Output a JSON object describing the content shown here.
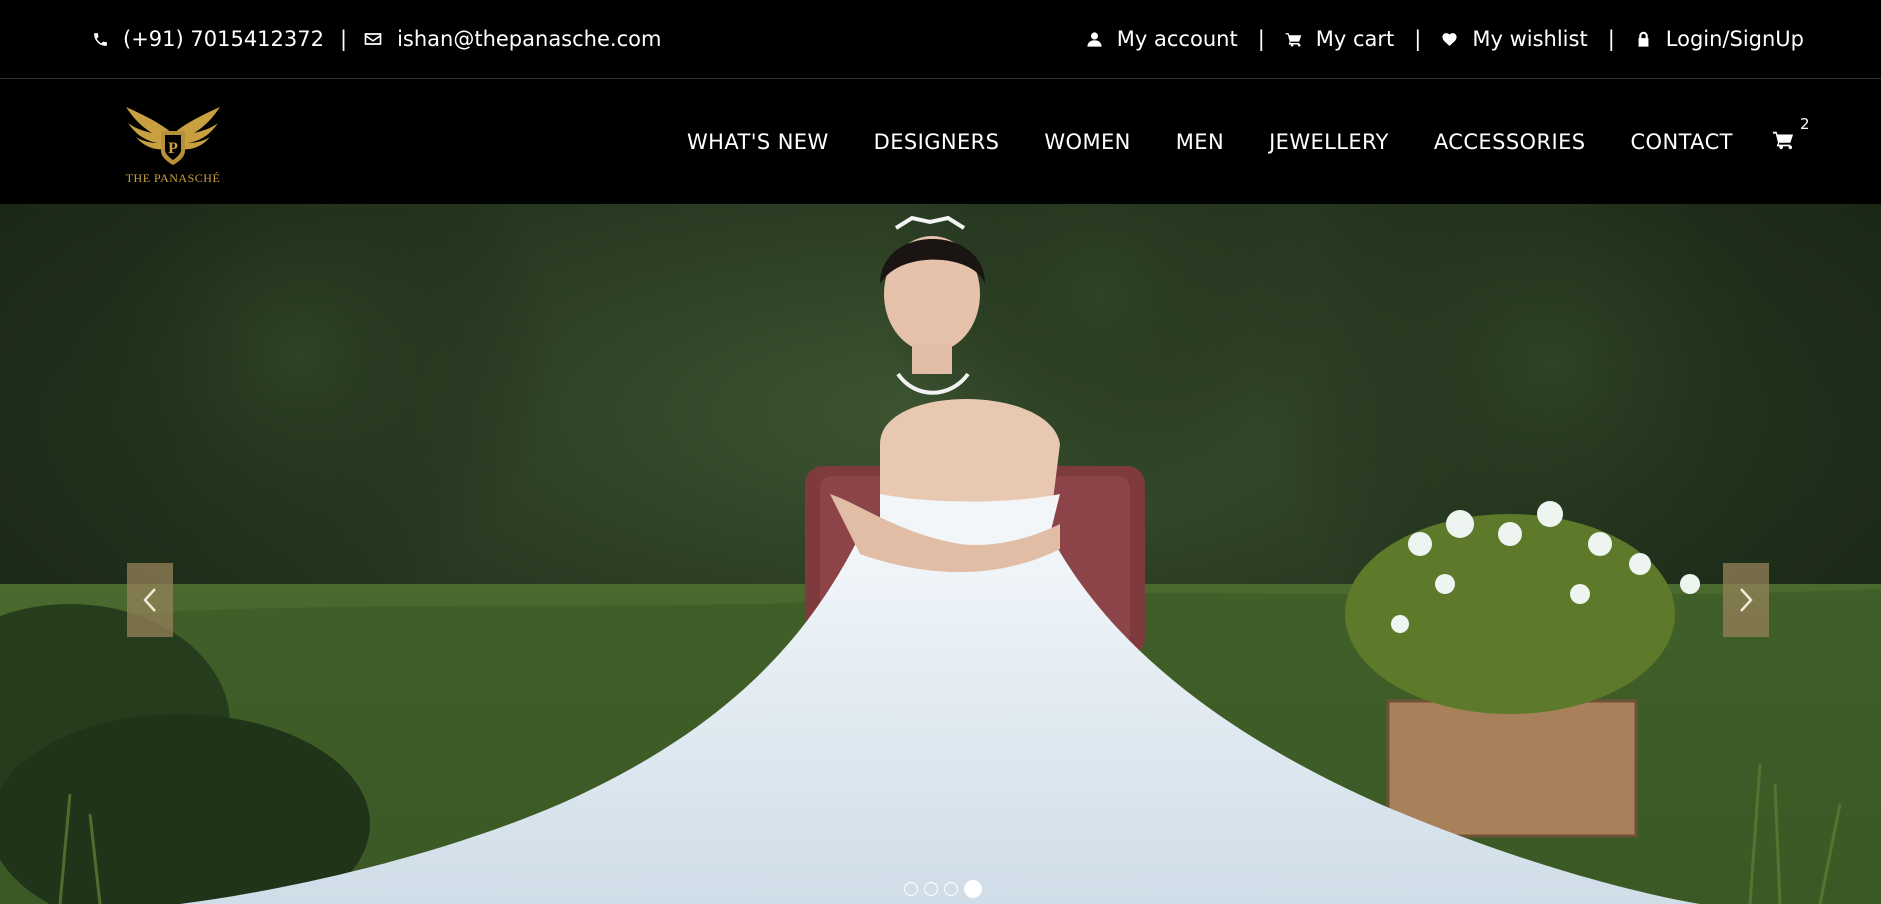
{
  "topbar": {
    "phone": "(+91) 7015412372",
    "email": "ishan@thepanasche.com",
    "separator": "|",
    "links": [
      {
        "label": "My account",
        "icon": "user-icon"
      },
      {
        "label": "My cart",
        "icon": "cart-icon"
      },
      {
        "label": "My wishlist",
        "icon": "heart-icon"
      },
      {
        "label": "Login/SignUp",
        "icon": "lock-icon"
      }
    ]
  },
  "header": {
    "logo_text": "THE PANASCHÉ",
    "nav": [
      "WHAT'S NEW",
      "DESIGNERS",
      "WOMEN",
      "MEN",
      "JEWELLERY",
      "ACCESSORIES",
      "CONTACT"
    ],
    "cart_count": "2"
  },
  "hero": {
    "slide_count": 4,
    "active_slide": 4,
    "image": "bride-in-white-gown-sitting-outdoors"
  },
  "colors": {
    "background": "#000000",
    "logo_gold": "#c9a040",
    "arrow_bg": "#9a8258"
  }
}
